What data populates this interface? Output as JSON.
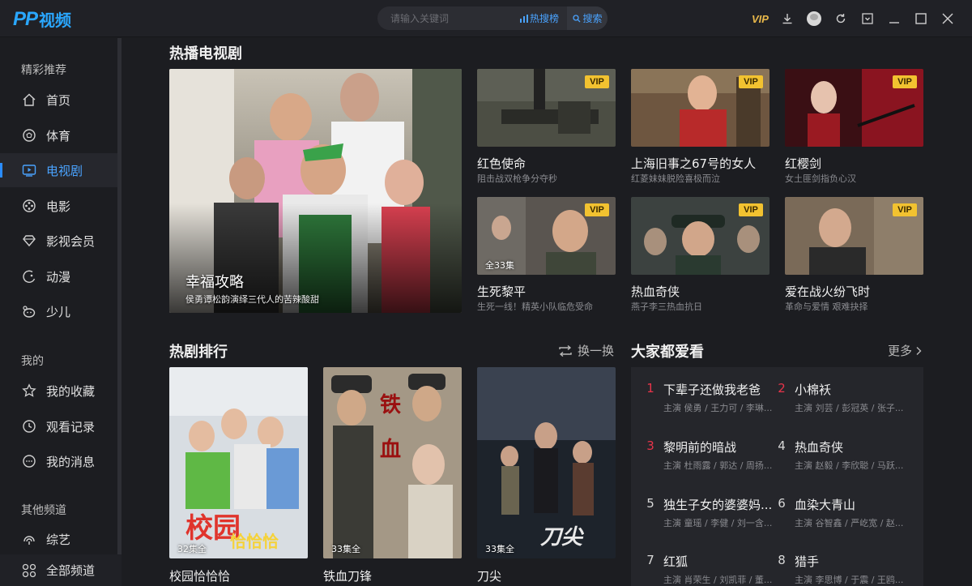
{
  "app": {
    "logo_mark": "PP",
    "logo_text": "视频"
  },
  "search": {
    "placeholder": "请输入关键词",
    "hot_label": "热搜榜",
    "button_label": "搜索"
  },
  "topbar": {
    "vip_label": "VIP"
  },
  "sidebar": {
    "group_featured": "精彩推荐",
    "group_mine": "我的",
    "group_other": "其他频道",
    "items": [
      {
        "label": "首页",
        "icon": "home-icon"
      },
      {
        "label": "体育",
        "icon": "sports-ball-icon"
      },
      {
        "label": "电视剧",
        "icon": "tv-icon"
      },
      {
        "label": "电影",
        "icon": "film-reel-icon"
      },
      {
        "label": "影视会员",
        "icon": "diamond-icon"
      },
      {
        "label": "动漫",
        "icon": "anime-icon"
      },
      {
        "label": "少儿",
        "icon": "kids-icon"
      },
      {
        "label": "我的收藏",
        "icon": "star-icon"
      },
      {
        "label": "观看记录",
        "icon": "clock-icon"
      },
      {
        "label": "我的消息",
        "icon": "message-icon"
      },
      {
        "label": "综艺",
        "icon": "variety-icon"
      }
    ],
    "all_channels": "全部频道"
  },
  "hot_tv": {
    "title": "热播电视剧",
    "featured": {
      "title": "幸福攻略",
      "subtitle": "侯勇谭松韵演绎三代人的苦辣酸甜"
    },
    "cards": [
      {
        "title": "红色使命",
        "subtitle": "阻击战双枪争分夺秒",
        "badge": "VIP",
        "episodes": ""
      },
      {
        "title": "上海旧事之67号的女人",
        "subtitle": "红菱妹妹脱险喜极而泣",
        "badge": "VIP",
        "episodes": ""
      },
      {
        "title": "红樱剑",
        "subtitle": "女土匪剑指负心汉",
        "badge": "VIP",
        "episodes": ""
      },
      {
        "title": "生死黎平",
        "subtitle": "生死一线！精英小队临危受命",
        "badge": "VIP",
        "episodes": "全33集"
      },
      {
        "title": "热血奇侠",
        "subtitle": "燕子李三热血抗日",
        "badge": "VIP",
        "episodes": ""
      },
      {
        "title": "爱在战火纷飞时",
        "subtitle": "革命与爱情 艰难抉择",
        "badge": "VIP",
        "episodes": ""
      }
    ]
  },
  "ranking": {
    "title": "热剧排行",
    "refresh_label": "换一换",
    "posters": [
      {
        "title": "校园恰恰恰",
        "episodes": "32集全"
      },
      {
        "title": "铁血刀锋",
        "episodes": "33集全"
      },
      {
        "title": "刀尖",
        "episodes": "33集全"
      }
    ]
  },
  "popular": {
    "title": "大家都爱看",
    "more_label": "更多",
    "items": [
      {
        "num": "1",
        "name": "下辈子还做我老爸",
        "cast": "主演 侯勇 / 王力可 / 李琳...",
        "highlight": true
      },
      {
        "num": "2",
        "name": "小棉袄",
        "cast": "主演 刘芸 / 彭冠英 / 张子...",
        "highlight": true
      },
      {
        "num": "3",
        "name": "黎明前的暗战",
        "cast": "主演 杜雨露 / 郭达 / 周扬...",
        "highlight": true
      },
      {
        "num": "4",
        "name": "热血奇侠",
        "cast": "主演 赵毅 / 李欣聪 / 马跃...",
        "highlight": false
      },
      {
        "num": "5",
        "name": "独生子女的婆婆妈...",
        "cast": "主演 童瑶 / 李健 / 刘一含...",
        "highlight": false
      },
      {
        "num": "6",
        "name": "血染大青山",
        "cast": "主演 谷智鑫 / 严屹宽 / 赵...",
        "highlight": false
      },
      {
        "num": "7",
        "name": "红狐",
        "cast": "主演 肖荣生 / 刘凯菲 / 董...",
        "highlight": false
      },
      {
        "num": "8",
        "name": "猎手",
        "cast": "主演 李思博 / 于震 / 王鸥...",
        "highlight": false
      }
    ]
  },
  "colors": {
    "accent": "#2a8cff",
    "vip_badge": "#f2c230",
    "rank_red": "#e8344a",
    "background": "#1c1d21"
  }
}
